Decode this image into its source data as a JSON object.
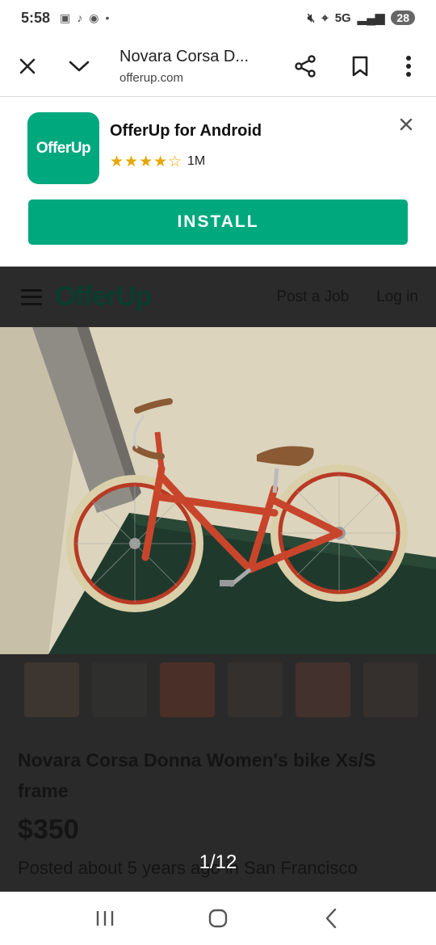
{
  "status": {
    "time": "5:58",
    "network": "5G",
    "battery": "28"
  },
  "toolbar": {
    "title": "Novara Corsa D...",
    "url": "offerup.com"
  },
  "banner": {
    "logo_text": "OfferUp",
    "app_name": "OfferUp for Android",
    "rating_stars": "★★★★☆",
    "downloads": "1M",
    "install_label": "INSTALL"
  },
  "site": {
    "logo": "OfferUp",
    "post_job": "Post a Job",
    "login": "Log in"
  },
  "listing": {
    "title": "Novara Corsa Donna Women's bike Xs/S frame",
    "price": "$350",
    "posted": "Posted about 5 years ago in San Francisco",
    "photo_counter": "1/12"
  },
  "colors": {
    "brand_green": "#00a87e",
    "overlay": "#2a2a2a",
    "bike_red": "#c8452b"
  }
}
